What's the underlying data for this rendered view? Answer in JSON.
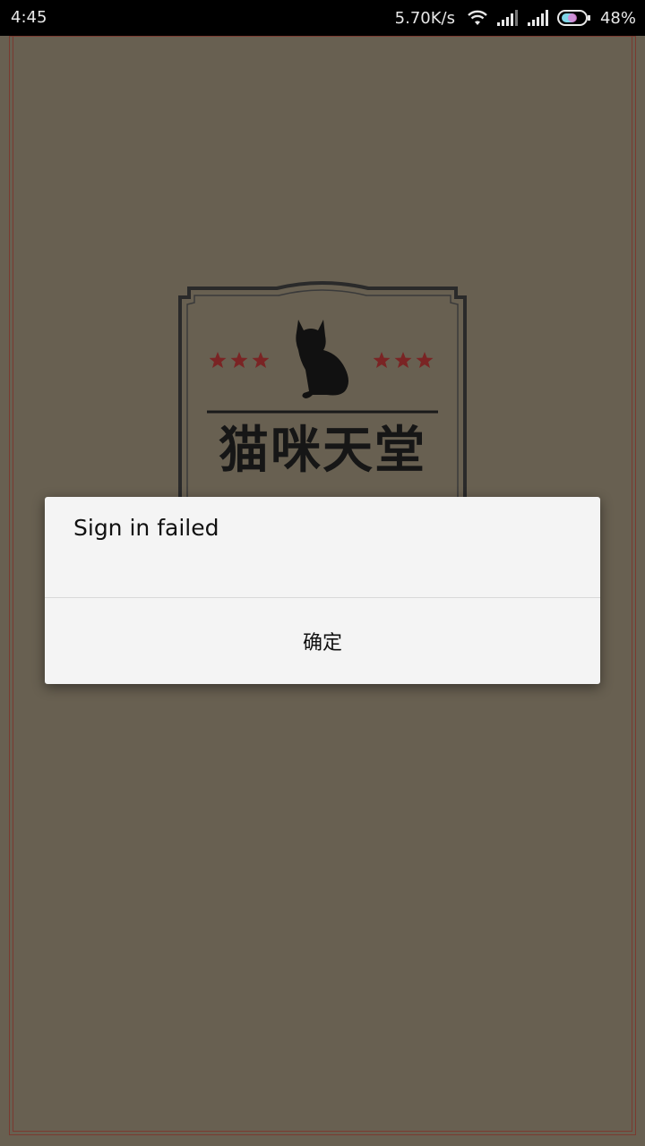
{
  "status_bar": {
    "time": "4:45",
    "network_speed": "5.70K/s",
    "battery_percent": "48%",
    "icons": [
      "wifi-icon",
      "signal-icon",
      "signal-icon",
      "battery-icon"
    ]
  },
  "logo": {
    "title": "猫咪天堂",
    "icon": "cat-icon",
    "star_color": "#7a2424"
  },
  "dialog": {
    "message": "Sign in failed",
    "confirm_label": "确定"
  },
  "colors": {
    "background": "#686051",
    "frame_line": "#7a3a30",
    "dialog_bg": "#f4f4f4"
  }
}
